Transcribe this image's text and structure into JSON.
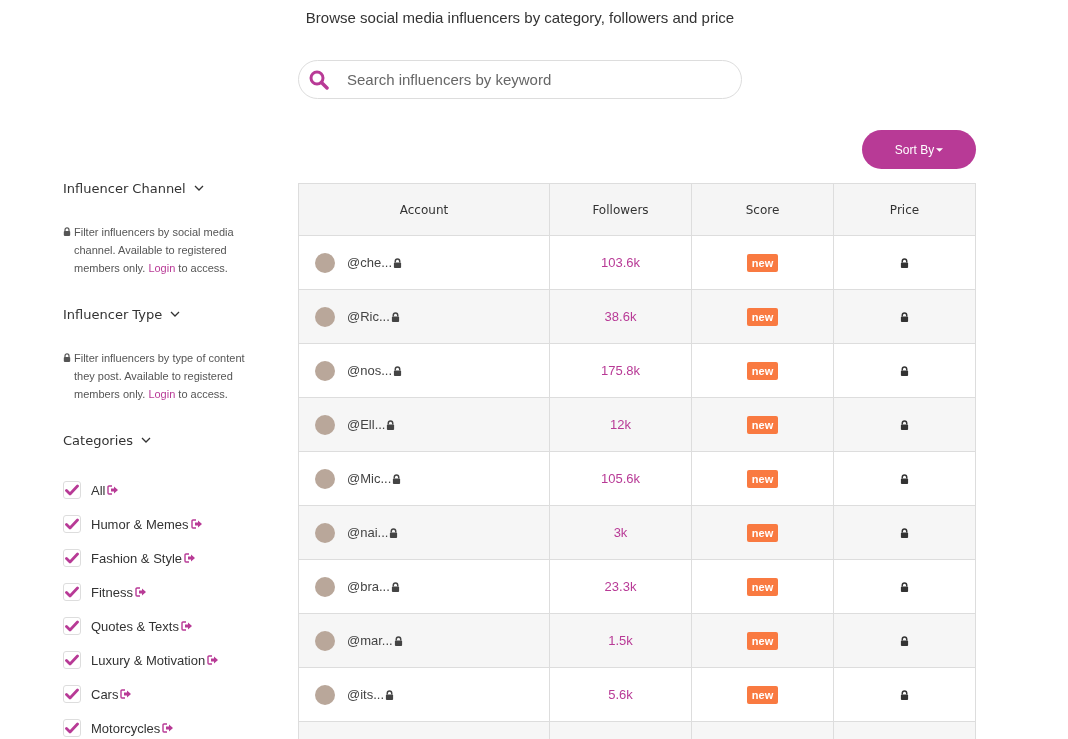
{
  "subtitle": "Browse social media influencers by category, followers and price",
  "search": {
    "placeholder": "Search influencers by keyword"
  },
  "sort_button": {
    "label": "Sort By"
  },
  "sidebar": {
    "sections": [
      {
        "title": "Influencer Channel",
        "kind": "locked",
        "note_before": "Filter influencers by social media channel. Available to registered members only.",
        "link": "Login",
        "note_after": "to access."
      },
      {
        "title": "Influencer Type",
        "kind": "locked",
        "note_before": "Filter influencers by type of content they post. Available to registered members only.",
        "link": "Login",
        "note_after": "to access."
      },
      {
        "title": "Categories",
        "kind": "checklist",
        "items": [
          {
            "label": "All",
            "checked": true
          },
          {
            "label": "Humor & Memes",
            "checked": true
          },
          {
            "label": "Fashion & Style",
            "checked": true
          },
          {
            "label": "Fitness",
            "checked": true
          },
          {
            "label": "Quotes & Texts",
            "checked": true
          },
          {
            "label": "Luxury & Motivation",
            "checked": true
          },
          {
            "label": "Cars",
            "checked": true
          },
          {
            "label": "Motorcycles",
            "checked": true
          }
        ]
      }
    ]
  },
  "table": {
    "columns": [
      "Account",
      "Followers",
      "Score",
      "Price"
    ],
    "rows": [
      {
        "account": "@che...",
        "followers": "103.6k",
        "score": "new"
      },
      {
        "account": "@Ric...",
        "followers": "38.6k",
        "score": "new"
      },
      {
        "account": "@nos...",
        "followers": "175.8k",
        "score": "new"
      },
      {
        "account": "@Ell...",
        "followers": "12k",
        "score": "new"
      },
      {
        "account": "@Mic...",
        "followers": "105.6k",
        "score": "new"
      },
      {
        "account": "@nai...",
        "followers": "3k",
        "score": "new"
      },
      {
        "account": "@bra...",
        "followers": "23.3k",
        "score": "new"
      },
      {
        "account": "@mar...",
        "followers": "1.5k",
        "score": "new"
      },
      {
        "account": "@its...",
        "followers": "5.6k",
        "score": "new"
      }
    ]
  }
}
